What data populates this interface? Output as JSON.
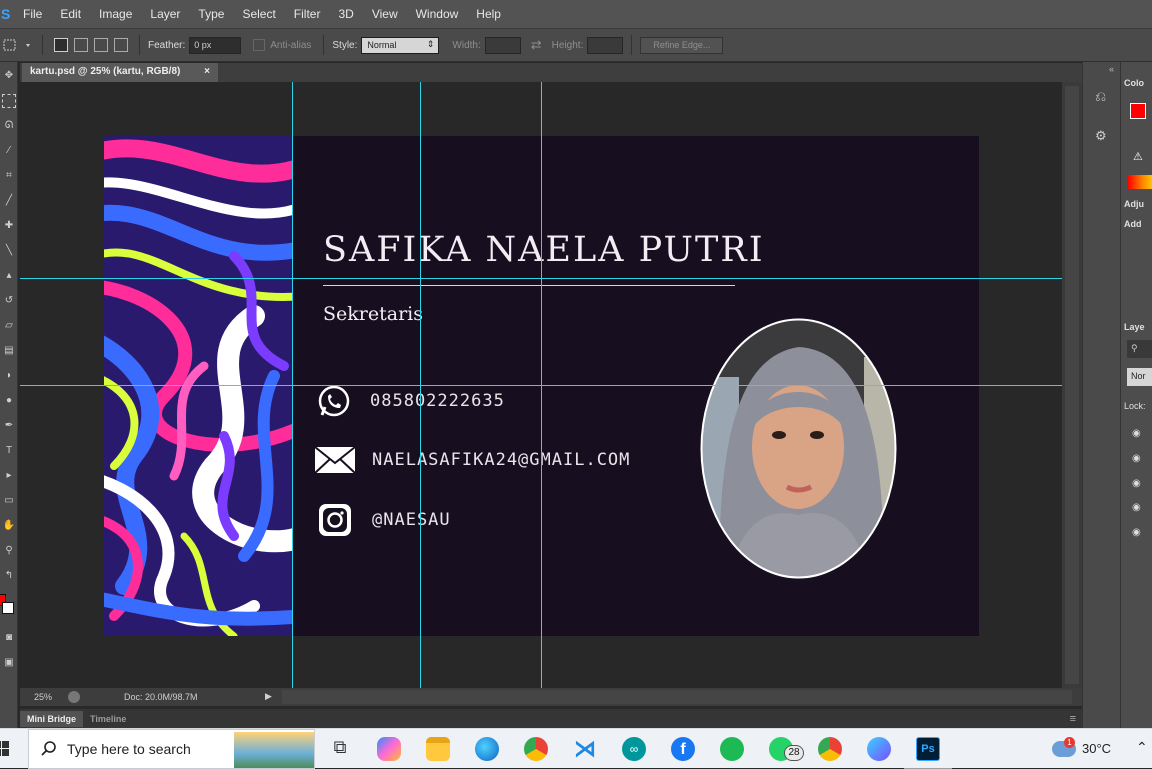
{
  "app": {
    "logo": "S"
  },
  "menu": [
    "File",
    "Edit",
    "Image",
    "Layer",
    "Type",
    "Select",
    "Filter",
    "3D",
    "View",
    "Window",
    "Help"
  ],
  "options": {
    "feather_label": "Feather:",
    "feather_value": "0 px",
    "antialias_label": "Anti-alias",
    "style_label": "Style:",
    "style_value": "Normal",
    "width_label": "Width:",
    "height_label": "Height:",
    "refine_label": "Refine Edge..."
  },
  "document": {
    "tab_title": "kartu.psd @ 25% (kartu, RGB/8)",
    "tab_close": "×",
    "zoom": "25%",
    "doc_info": "Doc: 20.0M/98.7M"
  },
  "card": {
    "name": "SAFIKA NAELA PUTRI",
    "role": "Sekretaris",
    "phone": "085802222635",
    "email": "NAELASAFIKA24@GMAIL.COM",
    "instagram": "@NAESAU"
  },
  "bottom_tabs": [
    "Mini Bridge",
    "Timeline"
  ],
  "right_panel": {
    "color_tab": "Colo",
    "adjust_tab": "Adju",
    "add_label": "Add",
    "layers_tab": "Laye",
    "blend_mode": "Nor",
    "lock_label": "Lock:",
    "fg_color": "#ff0000"
  },
  "taskbar": {
    "search_placeholder": "Type here to search",
    "whatsapp_badge": "28",
    "weather_temp": "30°C",
    "weather_badge": "1"
  }
}
